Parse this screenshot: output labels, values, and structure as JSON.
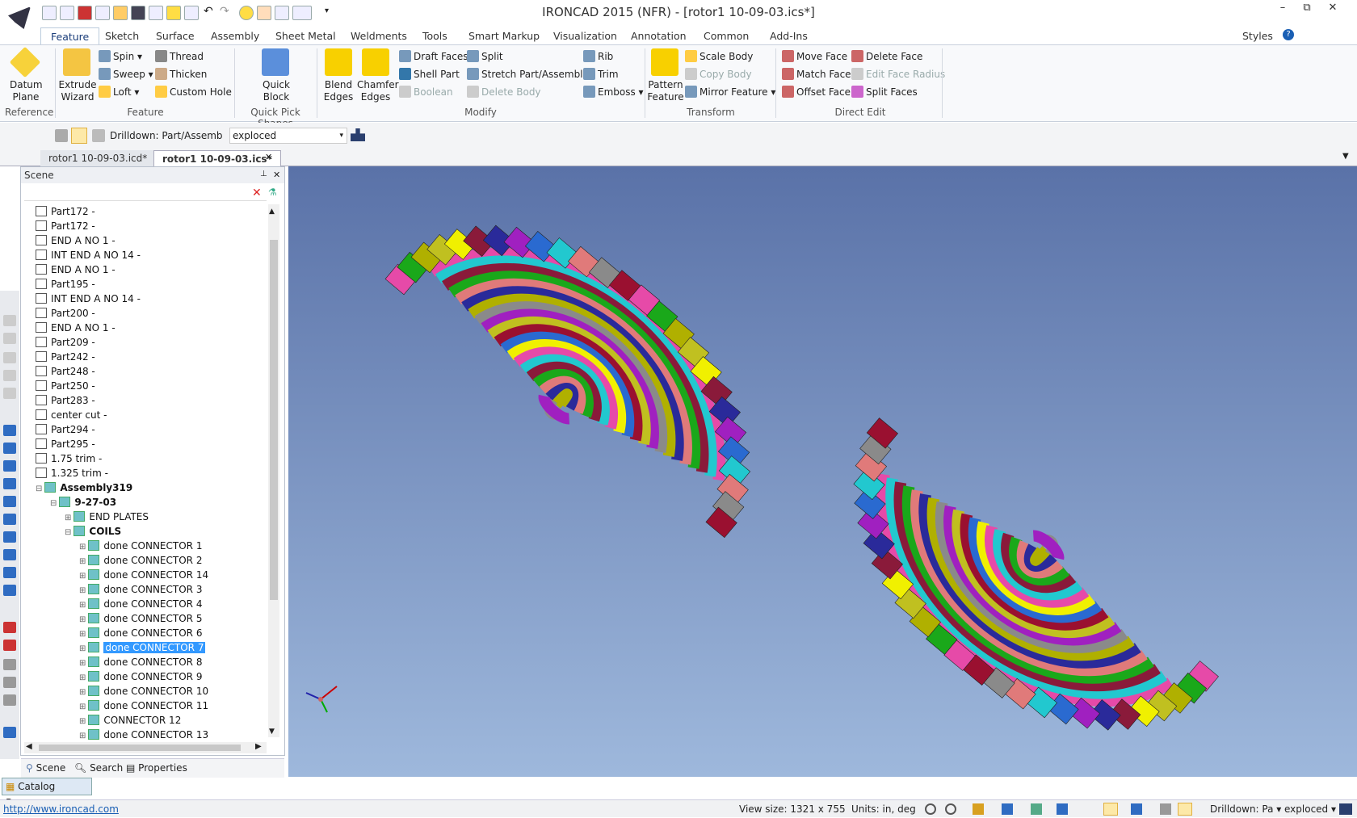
{
  "window": {
    "title": "IRONCAD 2015 (NFR) - [rotor1 10-09-03.ics*]",
    "minimize": "–",
    "restore": "⧉",
    "close": "✕"
  },
  "menu_tabs": [
    "Feature",
    "Sketch",
    "Surface",
    "Assembly",
    "Sheet Metal",
    "Weldments",
    "Tools",
    "Smart Markup",
    "Visualization",
    "Annotation",
    "Common",
    "Add-Ins"
  ],
  "styles_label": "Styles",
  "ribbon": {
    "datum_plane": "Datum Plane",
    "extrude_wizard": "Extrude Wizard",
    "spin": "Spin",
    "sweep": "Sweep",
    "loft": "Loft",
    "thread": "Thread",
    "thicken": "Thicken",
    "custom_hole": "Custom Hole",
    "quick_block": "Quick Block",
    "blend_edges": "Blend Edges",
    "chamfer_edges": "Chamfer Edges",
    "draft_faces": "Draft Faces",
    "shell_part": "Shell Part",
    "boolean": "Boolean",
    "split": "Split",
    "stretch": "Stretch Part/Assembly",
    "delete_body": "Delete Body",
    "rib": "Rib",
    "trim": "Trim",
    "emboss": "Emboss",
    "pattern_feature": "Pattern Feature",
    "scale_body": "Scale Body",
    "copy_body": "Copy Body",
    "mirror_feature": "Mirror Feature",
    "move_face": "Move Face",
    "match_face": "Match Face",
    "offset_face": "Offset Face",
    "delete_face": "Delete Face",
    "edit_face_radius": "Edit Face Radius",
    "split_faces": "Split Faces",
    "groups": {
      "reference": "Reference",
      "feature": "Feature",
      "quick_pick": "Quick Pick Shapes",
      "modify": "Modify",
      "transform": "Transform",
      "direct_edit": "Direct Edit"
    }
  },
  "toolbar2": {
    "drilldown": "Drilldown: Part/Assemb",
    "view_state": "exploced"
  },
  "doc_tabs": [
    "rotor1 10-09-03.icd*",
    "rotor1 10-09-03.ics*"
  ],
  "scene": {
    "title": "Scene",
    "items": [
      {
        "label": "Part172 -",
        "indent": 0,
        "kind": "part"
      },
      {
        "label": "Part172 -",
        "indent": 0,
        "kind": "part"
      },
      {
        "label": "END A NO 1 -",
        "indent": 0,
        "kind": "part"
      },
      {
        "label": "INT END A NO 14 -",
        "indent": 0,
        "kind": "part"
      },
      {
        "label": "END A NO 1 -",
        "indent": 0,
        "kind": "part"
      },
      {
        "label": "Part195 -",
        "indent": 0,
        "kind": "part"
      },
      {
        "label": "INT END A NO 14 -",
        "indent": 0,
        "kind": "part"
      },
      {
        "label": "Part200 -",
        "indent": 0,
        "kind": "part"
      },
      {
        "label": "END A NO 1 -",
        "indent": 0,
        "kind": "part"
      },
      {
        "label": "Part209 -",
        "indent": 0,
        "kind": "part"
      },
      {
        "label": "Part242 -",
        "indent": 0,
        "kind": "part"
      },
      {
        "label": "Part248 -",
        "indent": 0,
        "kind": "part"
      },
      {
        "label": "Part250 -",
        "indent": 0,
        "kind": "part"
      },
      {
        "label": "Part283 -",
        "indent": 0,
        "kind": "part"
      },
      {
        "label": "center cut -",
        "indent": 0,
        "kind": "part"
      },
      {
        "label": "Part294 -",
        "indent": 0,
        "kind": "part"
      },
      {
        "label": "Part295 -",
        "indent": 0,
        "kind": "part"
      },
      {
        "label": "1.75 trim -",
        "indent": 0,
        "kind": "part"
      },
      {
        "label": "1.325 trim -",
        "indent": 0,
        "kind": "part"
      },
      {
        "label": "Assembly319",
        "indent": 0,
        "kind": "asm",
        "bold": true
      },
      {
        "label": "9-27-03",
        "indent": 1,
        "kind": "asm",
        "bold": true
      },
      {
        "label": "END PLATES",
        "indent": 2,
        "kind": "asm"
      },
      {
        "label": "COILS",
        "indent": 2,
        "kind": "asm",
        "bold": true
      },
      {
        "label": "done CONNECTOR 1",
        "indent": 3,
        "kind": "asm"
      },
      {
        "label": "done CONNECTOR 2",
        "indent": 3,
        "kind": "asm"
      },
      {
        "label": "done CONNECTOR 14",
        "indent": 3,
        "kind": "asm"
      },
      {
        "label": "done CONNECTOR 3",
        "indent": 3,
        "kind": "asm"
      },
      {
        "label": "done CONNECTOR 4",
        "indent": 3,
        "kind": "asm"
      },
      {
        "label": "done CONNECTOR 5",
        "indent": 3,
        "kind": "asm"
      },
      {
        "label": "done CONNECTOR 6",
        "indent": 3,
        "kind": "asm"
      },
      {
        "label": "done CONNECTOR 7",
        "indent": 3,
        "kind": "asm",
        "selected": true
      },
      {
        "label": "done CONNECTOR 8",
        "indent": 3,
        "kind": "asm"
      },
      {
        "label": "done CONNECTOR 9",
        "indent": 3,
        "kind": "asm"
      },
      {
        "label": "done CONNECTOR 10",
        "indent": 3,
        "kind": "asm"
      },
      {
        "label": "done CONNECTOR 11",
        "indent": 3,
        "kind": "asm"
      },
      {
        "label": "CONNECTOR 12",
        "indent": 3,
        "kind": "asm"
      },
      {
        "label": "done CONNECTOR 13",
        "indent": 3,
        "kind": "asm"
      }
    ],
    "tabs": [
      "Scene",
      "Search",
      "Properties"
    ]
  },
  "catalog_browser": "Catalog Browser",
  "status": {
    "url": "http://www.ironcad.com",
    "view_size": "View size: 1321 x 755",
    "units": "Units: in, deg",
    "drilldown": "Drilldown: Pa",
    "view_state": "exploced"
  },
  "colors": {
    "accent": "#1a3d7a",
    "selection": "#3399ff",
    "viewport_top": "#5a72a8",
    "viewport_bottom": "#9eb8dc"
  }
}
